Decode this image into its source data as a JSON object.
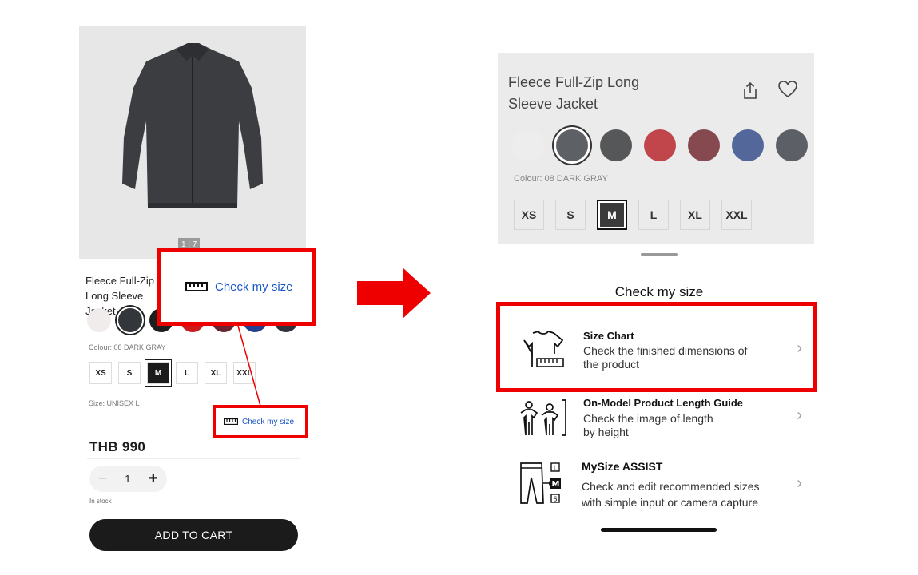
{
  "left_panel": {
    "image_pager": "1 | 7",
    "product_title": "Fleece Full-Zip Long Sleeve Jacket",
    "swatches": [
      {
        "color": "#f0ecec"
      },
      {
        "color": "#33363b",
        "selected": true
      },
      {
        "color": "#1e1e1e"
      },
      {
        "color": "#cc1b1b"
      },
      {
        "color": "#6a2530"
      },
      {
        "color": "#23418e"
      },
      {
        "color": "#30343a"
      }
    ],
    "colour_label": "Colour: 08 DARK GRAY",
    "sizes": [
      "XS",
      "S",
      "M",
      "L",
      "XL",
      "XXL"
    ],
    "selected_size": "M",
    "size_label": "Size: UNISEX L",
    "price": "THB 990",
    "quantity": "1",
    "stock": "In stock",
    "add_to_cart": "ADD TO CART",
    "check_my_size": "Check my size"
  },
  "callout": {
    "zoom_label": "Check my size",
    "highlight_color": "#ee0000"
  },
  "right_panel": {
    "product_title": "Fleece Full-Zip Long Sleeve Jacket",
    "swatches": [
      {
        "color": "#ededed"
      },
      {
        "color": "#5d6165",
        "selected": true
      },
      {
        "color": "#555759"
      },
      {
        "color": "#c0464b"
      },
      {
        "color": "#85494f"
      },
      {
        "color": "#53679a"
      },
      {
        "color": "#5c5f66"
      }
    ],
    "colour_label": "Colour: 08 DARK GRAY",
    "sizes": [
      "XS",
      "S",
      "M",
      "L",
      "XL",
      "XXL"
    ],
    "selected_size": "M",
    "sheet_title": "Check my size",
    "options": [
      {
        "title": "Size Chart",
        "desc_1": "Check the finished dimensions of",
        "desc_2": "the product",
        "icon": "tshirt-ruler-icon"
      },
      {
        "title": "On-Model Product Length Guide",
        "desc_1": "Check the image of length",
        "desc_2": "by height",
        "icon": "model-height-icon"
      },
      {
        "title": "MySize ASSIST",
        "desc_1": "Check and edit recommended sizes",
        "desc_2": "with simple input or camera capture",
        "icon": "pants-size-icon"
      }
    ]
  }
}
